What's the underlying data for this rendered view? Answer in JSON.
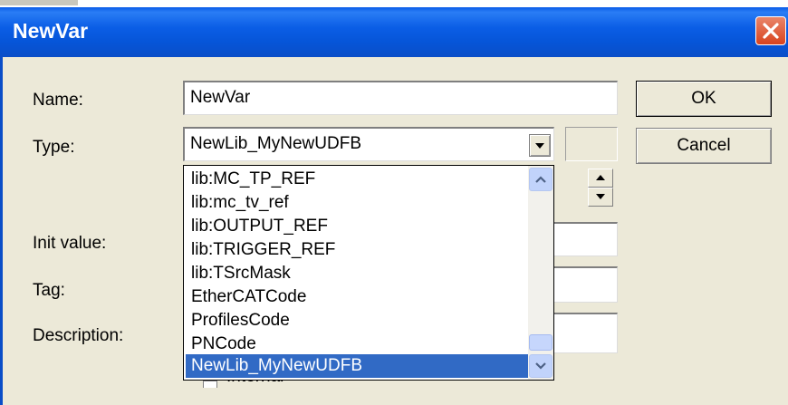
{
  "window": {
    "title": "NewVar"
  },
  "form": {
    "name_label": "Name:",
    "name_value": "NewVar",
    "type_label": "Type:",
    "type_value": "NewLib_MyNewUDFB",
    "init_label": "Init value:",
    "tag_label": "Tag:",
    "description_label": "Description:",
    "partial_label": "Internal"
  },
  "buttons": {
    "ok": "OK",
    "cancel": "Cancel"
  },
  "dropdown": {
    "items": [
      "lib:MC_TP_REF",
      "lib:mc_tv_ref",
      "lib:OUTPUT_REF",
      "lib:TRIGGER_REF",
      "lib:TSrcMask",
      "EtherCATCode",
      "ProfilesCode",
      "PNCode",
      "NewLib_MyNewUDFB"
    ],
    "selected": "NewLib_MyNewUDFB"
  },
  "colors": {
    "titlebar": "#0a5ce8",
    "selection": "#316ac5",
    "dialog": "#ece9d8"
  }
}
